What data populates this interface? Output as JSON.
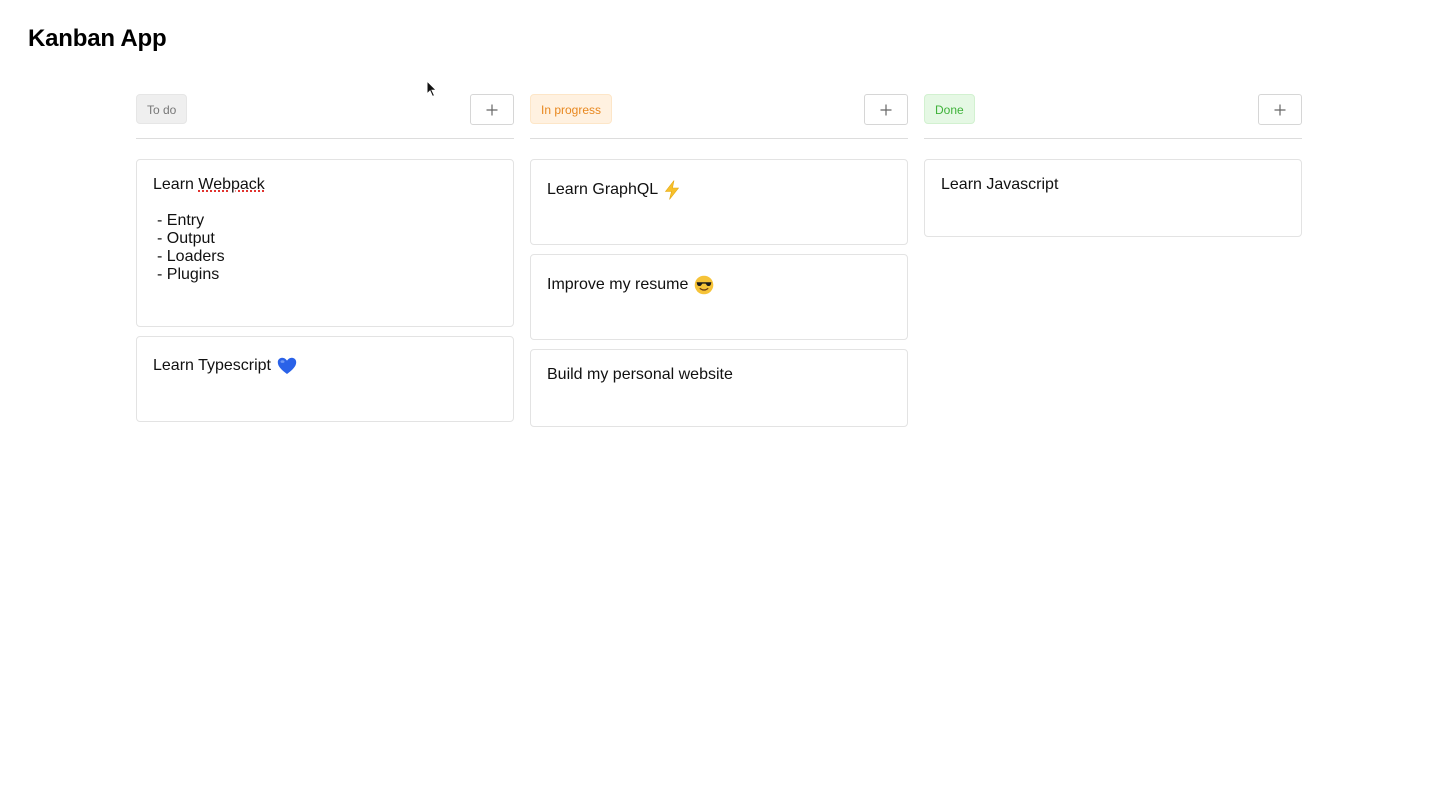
{
  "app": {
    "title": "Kanban App"
  },
  "colors": {
    "todo_badge_bg": "#efefef",
    "todo_badge_text": "#777777",
    "progress_badge_bg": "#fff1e0",
    "progress_badge_text": "#e8871e",
    "done_badge_bg": "#e5f8e4",
    "done_badge_text": "#3fb23a",
    "heart_blue": "#2a62e8",
    "bolt_yellow": "#f7c02b"
  },
  "columns": [
    {
      "label": "To do",
      "add_icon": "plus-icon",
      "cards": [
        {
          "title_prefix": "Learn ",
          "title_word": "Webpack",
          "lines": [
            "- Entry",
            "- Output",
            "- Loaders",
            "- Plugins"
          ]
        },
        {
          "title": "Learn Typescript",
          "icon": "blue-heart-icon"
        }
      ]
    },
    {
      "label": "In progress",
      "add_icon": "plus-icon",
      "cards": [
        {
          "title": "Learn GraphQL",
          "icon": "lightning-icon"
        },
        {
          "title": "Improve my resume",
          "icon": "sunglasses-face-icon"
        },
        {
          "title": "Build my personal website"
        }
      ]
    },
    {
      "label": "Done",
      "add_icon": "plus-icon",
      "cards": [
        {
          "title": "Learn Javascript"
        }
      ]
    }
  ]
}
